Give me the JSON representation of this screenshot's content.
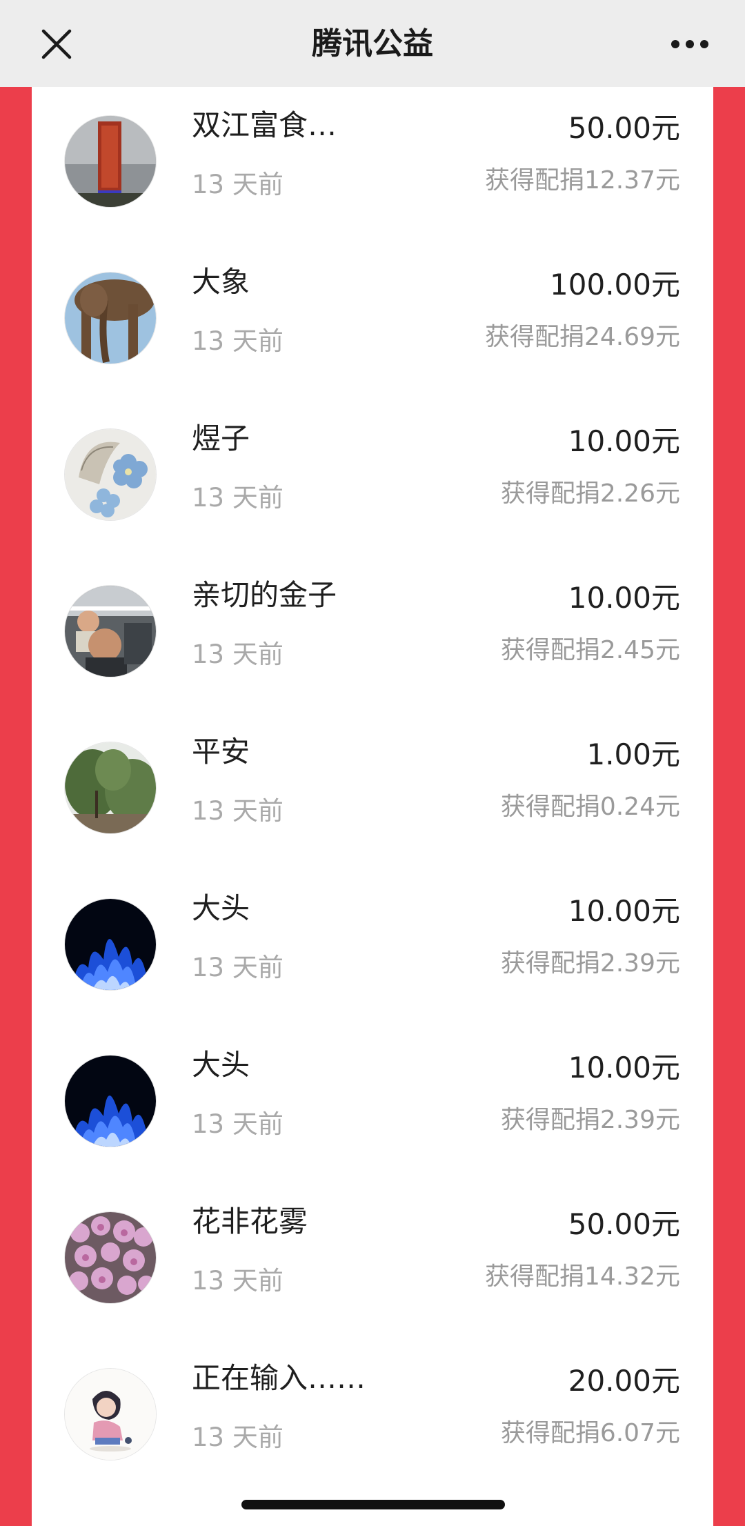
{
  "nav": {
    "title": "腾讯公益",
    "close_icon": "close-icon",
    "more_icon": "more-icon"
  },
  "colors": {
    "accent_red": "#ec3e4b",
    "nav_background": "#ededed"
  },
  "donations": [
    {
      "name": "双江富食…",
      "time": "13 天前",
      "amount": "50.00元",
      "match": "获得配捐12.37元",
      "avatar": "avatar-tower"
    },
    {
      "name": "大象",
      "time": "13 天前",
      "amount": "100.00元",
      "match": "获得配捐24.69元",
      "avatar": "avatar-elephant"
    },
    {
      "name": "煜子",
      "time": "13 天前",
      "amount": "10.00元",
      "match": "获得配捐2.26元",
      "avatar": "avatar-flowers"
    },
    {
      "name": "亲切的金子",
      "time": "13 天前",
      "amount": "10.00元",
      "match": "获得配捐2.45元",
      "avatar": "avatar-family"
    },
    {
      "name": "平安",
      "time": "13 天前",
      "amount": "1.00元",
      "match": "获得配捐0.24元",
      "avatar": "avatar-trees"
    },
    {
      "name": "大头",
      "time": "13 天前",
      "amount": "10.00元",
      "match": "获得配捐2.39元",
      "avatar": "avatar-blue-flame"
    },
    {
      "name": "大头",
      "time": "13 天前",
      "amount": "10.00元",
      "match": "获得配捐2.39元",
      "avatar": "avatar-blue-flame"
    },
    {
      "name": "花非花雾",
      "time": "13 天前",
      "amount": "50.00元",
      "match": "获得配捐14.32元",
      "avatar": "avatar-azalea"
    },
    {
      "name": "正在输入……",
      "time": "13 天前",
      "amount": "20.00元",
      "match": "获得配捐6.07元",
      "avatar": "avatar-cartoon-girl"
    }
  ]
}
